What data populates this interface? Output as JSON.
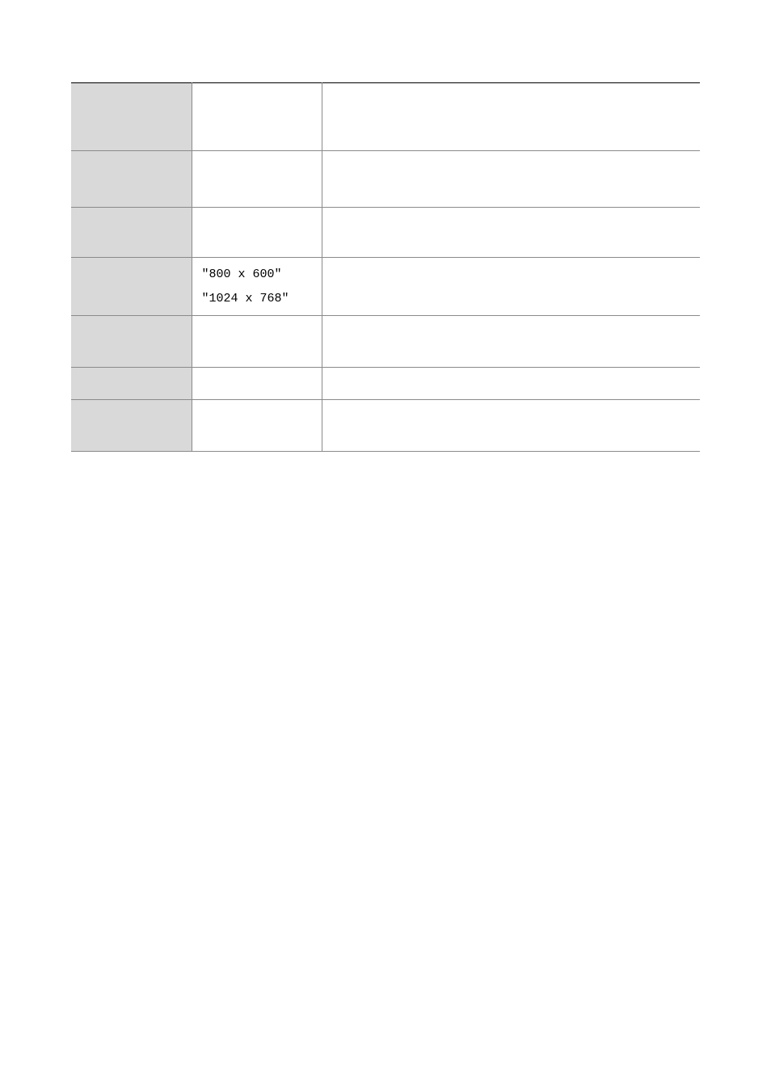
{
  "table": {
    "rows": [
      {
        "col1": "",
        "col2": "",
        "col3": ""
      },
      {
        "col1": "",
        "col2": "",
        "col3": ""
      },
      {
        "col1": "",
        "col2": "",
        "col3": ""
      },
      {
        "col1": "",
        "col2_line1": "\"800 x 600\"",
        "col2_line2": "\"1024 x 768\"",
        "col3": ""
      },
      {
        "col1": "",
        "col2": "",
        "col3": ""
      },
      {
        "col1": "",
        "col2": "",
        "col3": ""
      },
      {
        "col1": "",
        "col2": "",
        "col3": ""
      }
    ]
  }
}
